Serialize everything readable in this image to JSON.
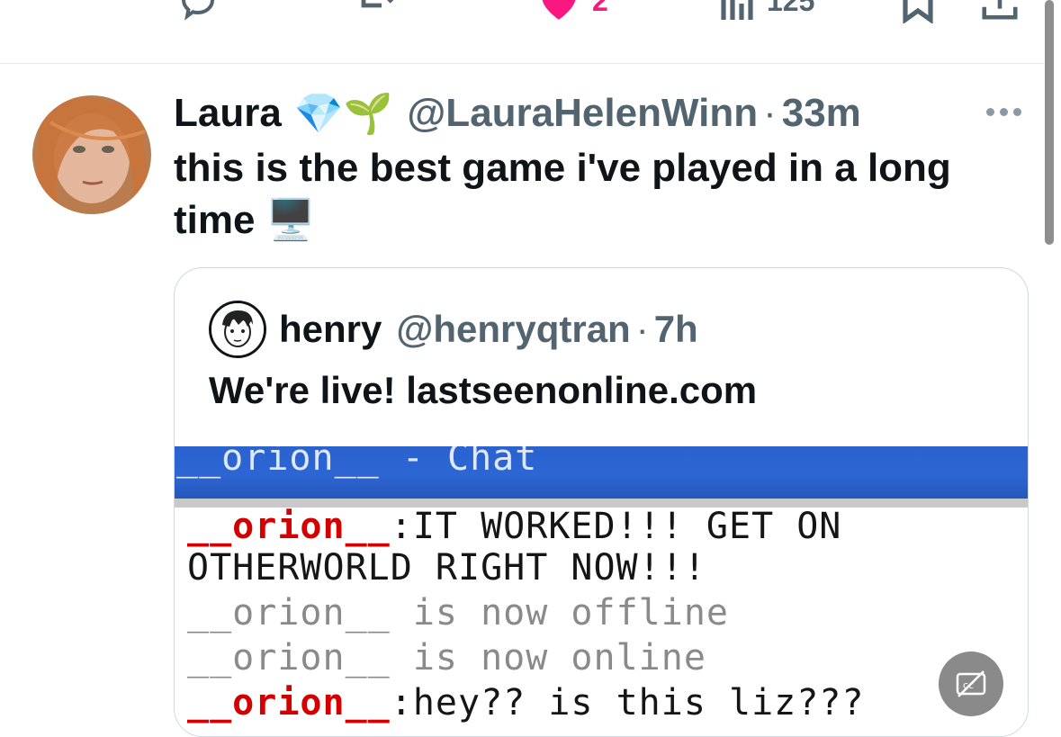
{
  "action_bar": {
    "like_count": "2",
    "views_count": "125"
  },
  "tweet": {
    "name": "Laura",
    "name_emojis": "💎🌱",
    "handle": "@LauraHelenWinn",
    "separator": "·",
    "time": "33m",
    "text": "this is the best game i've played in a long time",
    "text_emoji": "🖥️"
  },
  "quote": {
    "name": "henry",
    "handle": "@henryqtran",
    "separator": "·",
    "time": "7h",
    "text": "We're live! lastseenonline.com",
    "image": {
      "window_title": "__orion__ - Chat",
      "lines": [
        {
          "user": "__orion__",
          "message": ":IT WORKED!!! GET ON"
        },
        {
          "user": "",
          "message": "OTHERWORLD RIGHT NOW!!!"
        },
        {
          "user": "__orion__",
          "message": " is now offline"
        },
        {
          "user": "__orion__",
          "message": " is now online"
        },
        {
          "user": "__orion__",
          "message": ":hey?? is this liz???"
        }
      ]
    }
  },
  "colors": {
    "like_pink": "#f91880",
    "secondary_text": "#536471",
    "chat_title_blue": "#2d66d3",
    "chat_user_red": "#d20000"
  }
}
